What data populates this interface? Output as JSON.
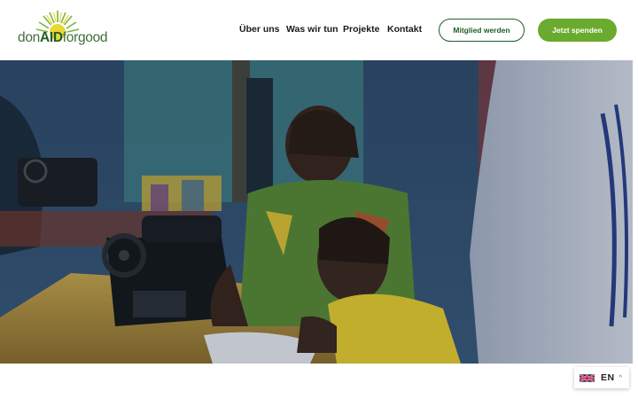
{
  "logo": {
    "pre": "don",
    "mid": "AID",
    "post": "forgood"
  },
  "nav": {
    "items": [
      {
        "label": "Über uns"
      },
      {
        "label": "Was wir tun"
      },
      {
        "label": "Projekte"
      },
      {
        "label": "Kontakt"
      }
    ]
  },
  "actions": {
    "member_label": "Mitglied werden",
    "donate_label": "Jetzt spenden"
  },
  "hero": {
    "description": ""
  },
  "language": {
    "code": "EN",
    "caret": "^"
  },
  "colors": {
    "brand_green_dark": "#1f5e2a",
    "brand_green": "#6aaa2e",
    "logo_yellow": "#e8d735"
  }
}
